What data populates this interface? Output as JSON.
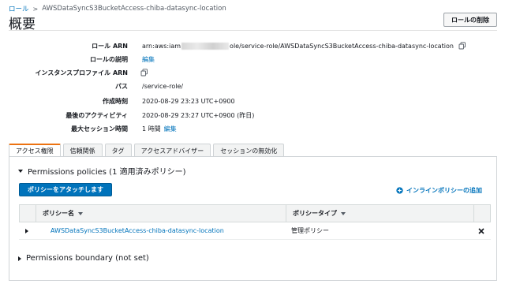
{
  "breadcrumb": {
    "root": "ロール",
    "current": "AWSDataSyncS3BucketAccess-chiba-datasync-location"
  },
  "page_title": "概要",
  "delete_button": "ロールの削除",
  "summary": {
    "role_arn": {
      "label": "ロール ARN",
      "prefix": "arn:aws:iam",
      "suffix": "ole/service-role/AWSDataSyncS3BucketAccess-chiba-datasync-location"
    },
    "description": {
      "label": "ロールの説明",
      "value": "編集"
    },
    "instance_profile": {
      "label": "インスタンスプロファイル ARN"
    },
    "path": {
      "label": "パス",
      "value": "/service-role/"
    },
    "created": {
      "label": "作成時刻",
      "value": "2020-08-29 23:23 UTC+0900"
    },
    "last_activity": {
      "label": "最後のアクティビティ",
      "value": "2020-08-29 23:27 UTC+0900 (昨日)"
    },
    "max_session": {
      "label": "最大セッション時間",
      "value": "1 時間",
      "edit": "編集"
    }
  },
  "tabs": [
    {
      "label": "アクセス権限",
      "active": true
    },
    {
      "label": "信頼関係"
    },
    {
      "label": "タグ"
    },
    {
      "label": "アクセスアドバイザー"
    },
    {
      "label": "セッションの無効化"
    }
  ],
  "permissions": {
    "header": "Permissions policies (1 適用済みポリシー)",
    "attach_button": "ポリシーをアタッチします",
    "inline_add": "インラインポリシーの追加",
    "columns": [
      "ポリシー名",
      "ポリシータイプ"
    ],
    "rows": [
      {
        "name": "AWSDataSyncS3BucketAccess-chiba-datasync-location",
        "type": "管理ポリシー"
      }
    ],
    "boundary": "Permissions boundary (not set)"
  },
  "colors": {
    "link": "#0073bb",
    "primary": "#0073bb",
    "tab_accent": "#ec7211"
  },
  "icons": {
    "copy": "copy-icon",
    "plus": "plus-circle-icon",
    "remove": "x-icon"
  }
}
